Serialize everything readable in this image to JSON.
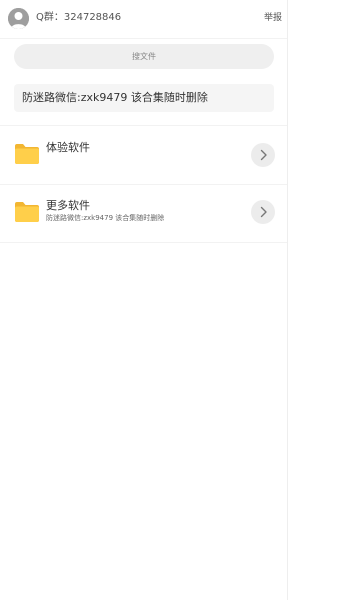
{
  "header": {
    "group_text": "Q群：324728846",
    "report_label": "举报"
  },
  "search": {
    "label": "搜文件"
  },
  "notice": {
    "text": "防迷路微信:zxk9479 该合集随时删除"
  },
  "folders": [
    {
      "title": "体验软件",
      "subtitle": ""
    },
    {
      "title": "更多软件",
      "subtitle": "防迷路微信:zxk9479 该合集随时删除"
    }
  ],
  "colors": {
    "folder": "#ffcf4a",
    "folder_tab": "#f2b632",
    "avatar": "#9e9e9e",
    "chevron_bg": "#ececec"
  },
  "icons": {
    "avatar": "user-avatar-icon",
    "folder": "folder-icon",
    "chevron": "chevron-right-icon"
  }
}
